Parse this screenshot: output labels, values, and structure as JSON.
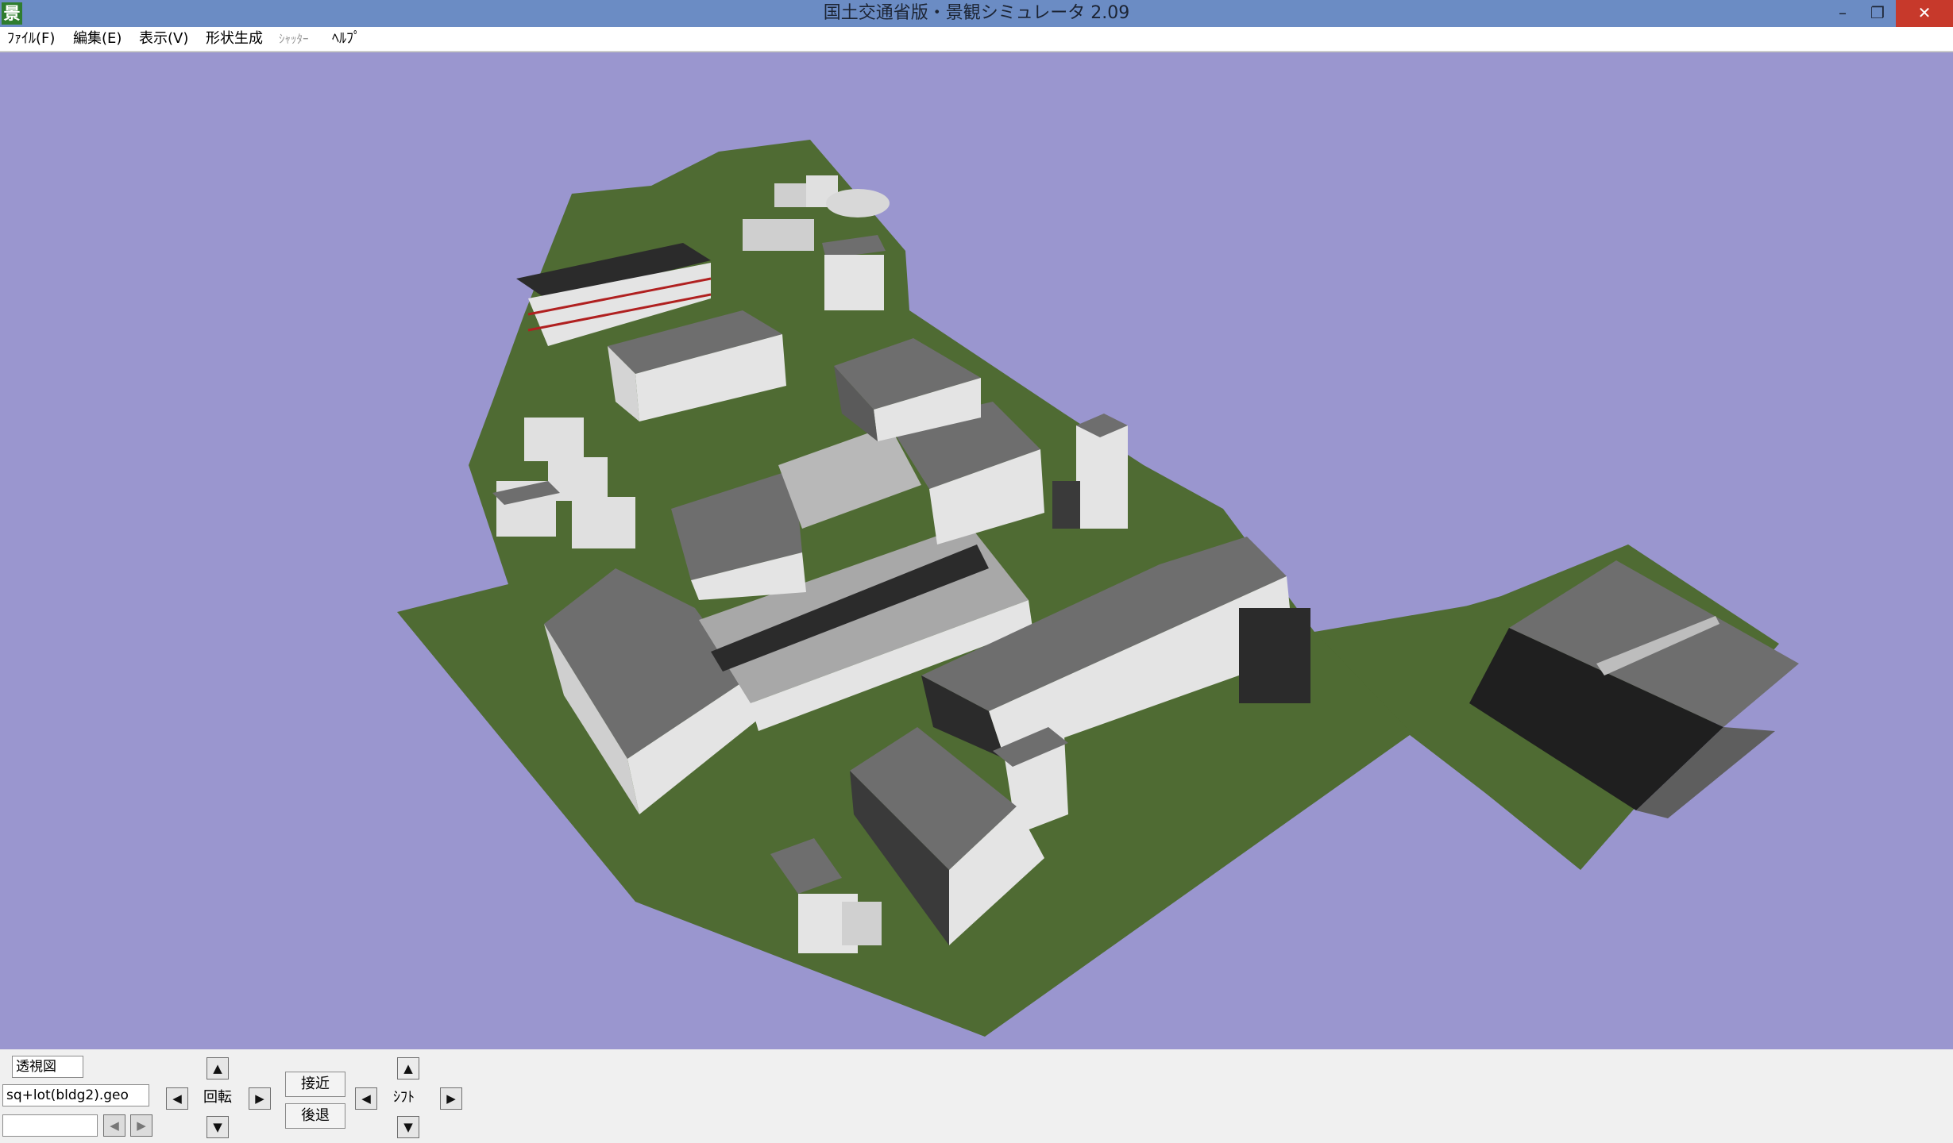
{
  "window": {
    "title": "国土交通省版・景観シミュレータ 2.09",
    "app_icon": "景",
    "controls": {
      "minimize": "–",
      "maximize": "❐",
      "close": "✕"
    }
  },
  "menu": {
    "items": [
      {
        "label": "ﾌｧｲﾙ(F)"
      },
      {
        "label": "編集(E)"
      },
      {
        "label": "表示(V)"
      },
      {
        "label": "形状生成"
      },
      {
        "label": "ｼｬｯﾀｰ",
        "disabled": true
      },
      {
        "label": "ﾍﾙﾌﾟ"
      }
    ]
  },
  "viewport": {
    "sky_color": "#9a96cf",
    "ground_color": "#4f6b33",
    "building_colors": [
      "#6e6e6e",
      "#e4e4e4",
      "#2b2b2b",
      "#a9a9a9"
    ]
  },
  "controls": {
    "view_mode": "透視図",
    "file_name": "sq+lot(bldg2).geo",
    "empty_field": "",
    "rotate_label": "回転",
    "approach_label": "接近",
    "retreat_label": "後退",
    "shift_label": "ｼﾌﾄ",
    "icons": {
      "up": "▲",
      "down": "▼",
      "left": "◀",
      "right": "▶"
    }
  }
}
